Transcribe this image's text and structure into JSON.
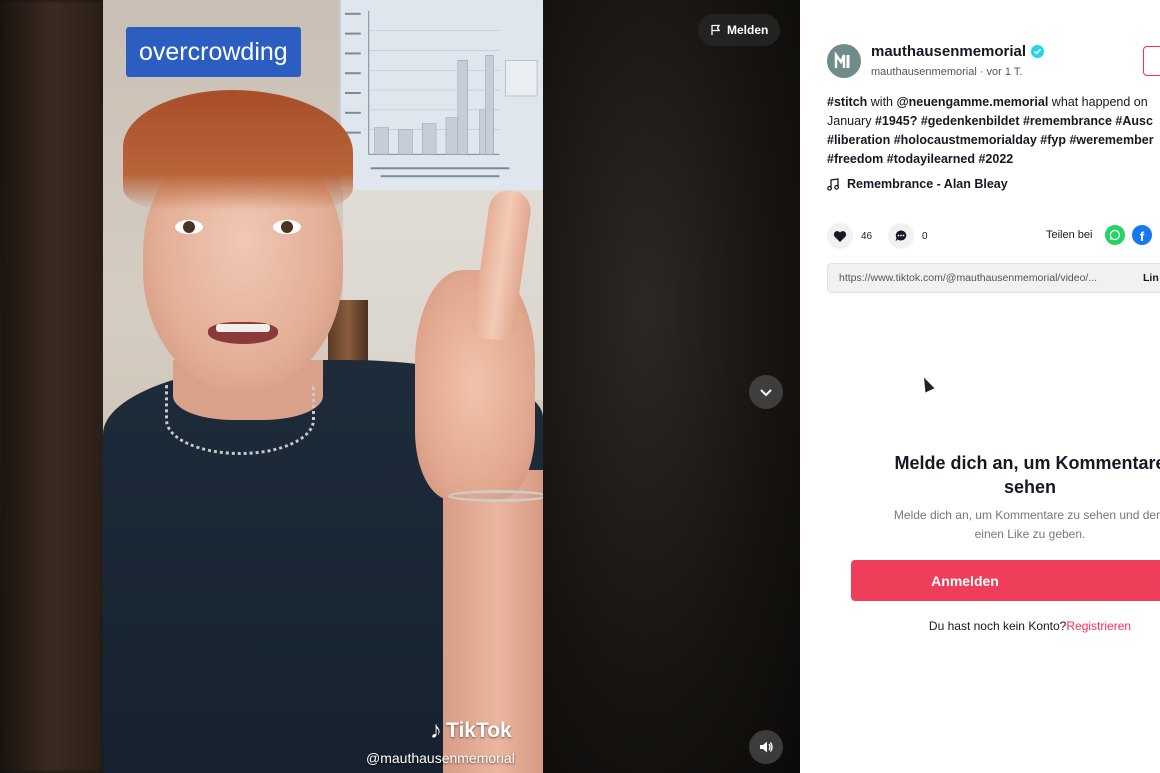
{
  "video": {
    "overlay_caption": "overcrowding",
    "watermark_brand": "TikTok",
    "watermark_handle": "@mauthausenmemorial",
    "report_label": "Melden"
  },
  "post": {
    "username": "mauthausenmemorial",
    "subline": "mauthausenmemorial · vor 1 T.",
    "description_lines": [
      [
        "#stitch",
        " with ",
        "@neuengamme.memorial",
        " what happend on"
      ],
      [
        "January ",
        "#1945?",
        " ",
        "#gedenkenbildet",
        " ",
        "#remembrance",
        " ",
        "#Ausc"
      ],
      [
        "#liberation",
        " ",
        "#holocaustmemorialday",
        " ",
        "#fyp",
        " ",
        "#weremember"
      ],
      [
        "#freedom",
        " ",
        "#todayilearned",
        " ",
        "#2022"
      ]
    ],
    "music": "Remembrance - Alan Bleay",
    "likes": "46",
    "comments": "0",
    "share_label": "Teilen bei",
    "link_url": "https://www.tiktok.com/@mauthausenmemorial/video/...",
    "copy_link_label": "Lin"
  },
  "login": {
    "title_line1": "Melde dich an, um Kommentare",
    "title_line2": "sehen",
    "sub_line1": "Melde dich an, um Kommentare zu sehen und dem",
    "sub_line2": "einen Like zu geben.",
    "button": "Anmelden",
    "no_account": "Du hast noch kein Konto?",
    "register": "Registrieren"
  },
  "colors": {
    "caption_bg": "#2b5ec0",
    "accent": "#fe2c55",
    "login_button": "#ee3e59",
    "verified": "#20d5ec",
    "whatsapp": "#25d366",
    "facebook": "#1877f2"
  },
  "icons": [
    "flag-icon",
    "chevron-down-icon",
    "volume-icon",
    "verified-icon",
    "music-note-icon",
    "heart-icon",
    "comment-icon",
    "whatsapp-icon",
    "facebook-icon",
    "tiktok-note-icon"
  ]
}
